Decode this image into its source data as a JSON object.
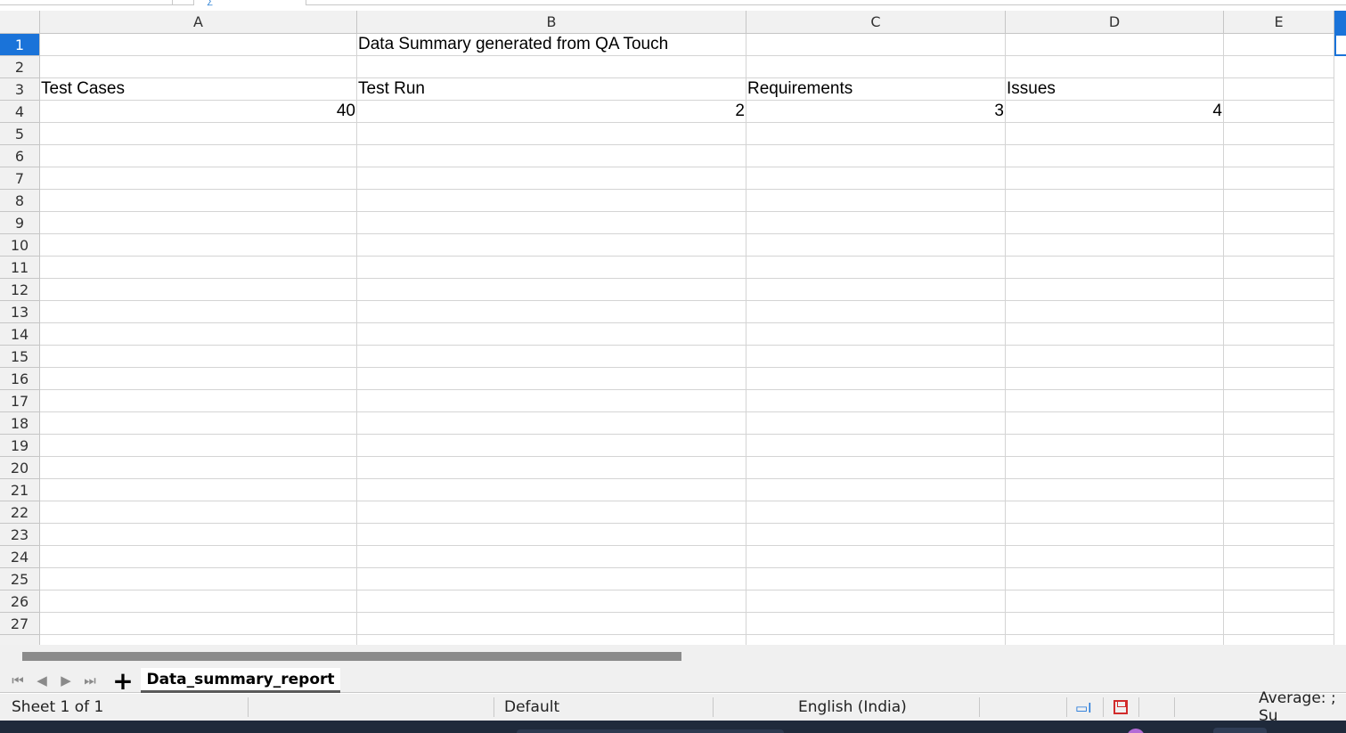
{
  "spreadsheet": {
    "columns": [
      "A",
      "B",
      "C",
      "D",
      "E"
    ],
    "rows": [
      "1",
      "2",
      "3",
      "4",
      "5",
      "6",
      "7",
      "8",
      "9",
      "10",
      "11",
      "12",
      "13",
      "14",
      "15",
      "16",
      "17",
      "18",
      "19",
      "20",
      "21",
      "22",
      "23",
      "24",
      "25",
      "26",
      "27"
    ],
    "active_row": "1",
    "cells": {
      "B1": "Data Summary generated from QA Touch",
      "A3": "Test Cases",
      "B3": "Test Run",
      "C3": "Requirements",
      "D3": "Issues",
      "A4": "40",
      "B4": "2",
      "C4": "3",
      "D4": "4"
    }
  },
  "sheet_tabs": {
    "active_tab": "Data_summary_report"
  },
  "statusbar": {
    "sheet_position": "Sheet 1 of 1",
    "page_style": "Default",
    "language": "English (India)",
    "summary": "Average: ; Su"
  },
  "colors": {
    "accent": "#1a73d9",
    "header_bg": "#f1f1f1",
    "gridline": "#d4d4d4"
  },
  "icons": [
    "first-sheet-icon",
    "prev-sheet-icon",
    "next-sheet-icon",
    "last-sheet-icon",
    "add-sheet-icon",
    "selection-mode-icon",
    "document-modified-icon"
  ]
}
